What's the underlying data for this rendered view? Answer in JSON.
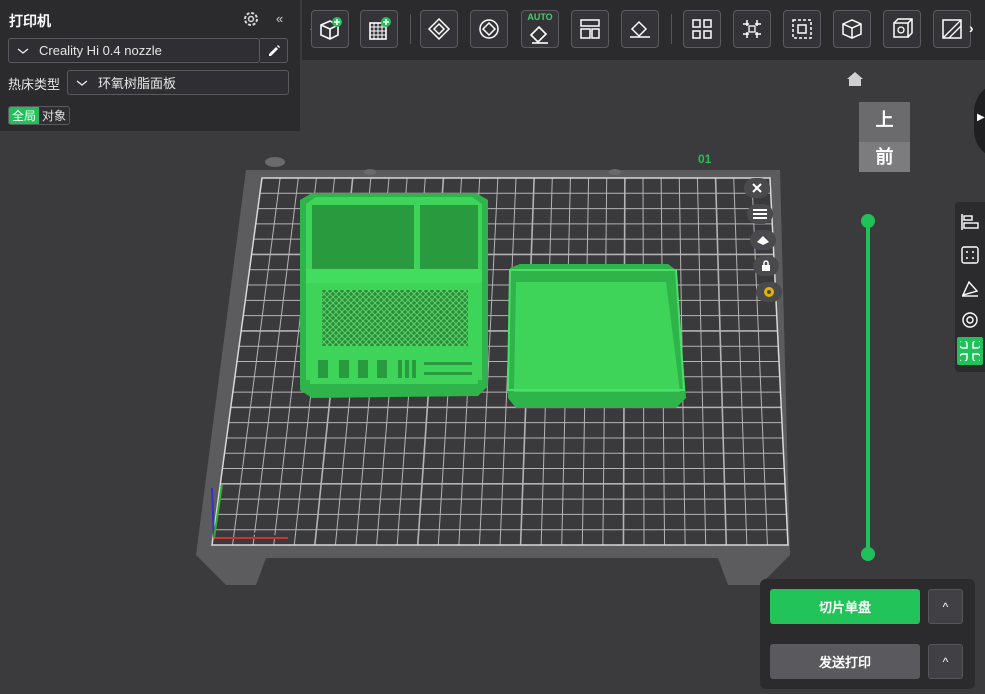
{
  "printer_panel": {
    "title": "打印机",
    "printer_name": "Creality Hi 0.4 nozzle",
    "bed_type_label": "热床类型",
    "bed_type_value": "环氧树脂面板",
    "scope_tabs": [
      "全局",
      "对象"
    ],
    "scope_active": "全局",
    "icons": [
      "gear-icon",
      "collapse-left-icon",
      "chevron-down-icon",
      "pencil-icon"
    ]
  },
  "toolbar": {
    "auto_label": "AUTO",
    "tools": [
      "add-object-icon",
      "add-plate-icon",
      "arrange-icon",
      "rotate-icon",
      "auto-orient-icon",
      "split-icon",
      "lay-on-face-icon",
      "cut-icon",
      "support-paint-icon",
      "seam-paint-icon",
      "measure-icon",
      "assembly-icon",
      "text-icon"
    ],
    "prev_icon": "chevron-left-icon",
    "next_icon": "chevron-right-icon"
  },
  "viewport": {
    "plate_label": "01",
    "view_cube_top": "上",
    "view_cube_front": "前",
    "plate_tools": [
      "close-icon",
      "list-icon",
      "orient-icon",
      "lock-icon",
      "settings-icon"
    ],
    "side_tools": [
      "align-icon",
      "grid-icon",
      "paint-icon",
      "filament-icon",
      "assemble-icon"
    ],
    "colors": {
      "model": "#3ed45a",
      "accent": "#20c05a",
      "plate_grid": "#c9c9c9"
    }
  },
  "actions": {
    "slice_label": "切片单盘",
    "send_label": "发送打印",
    "caret": "^"
  }
}
